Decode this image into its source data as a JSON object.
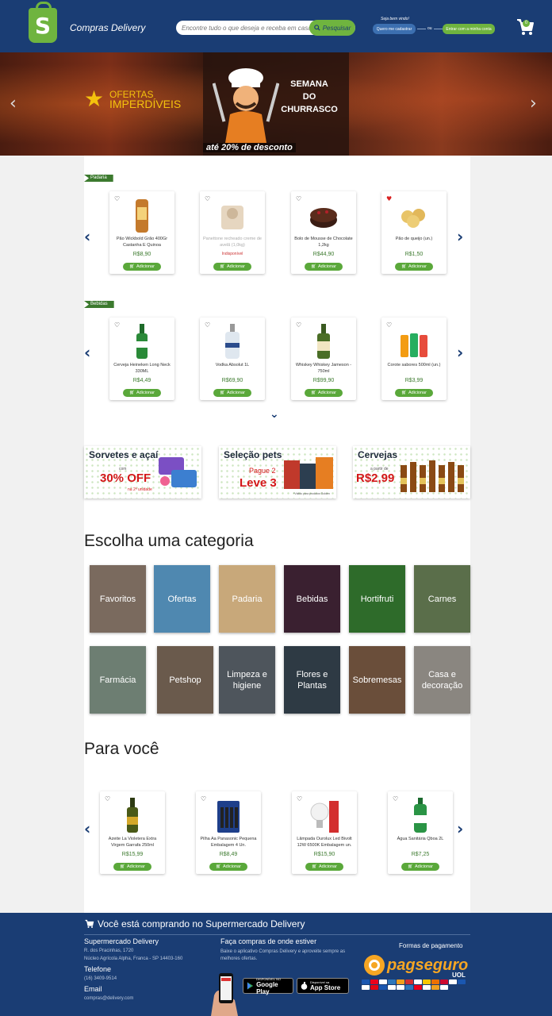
{
  "header": {
    "logo_letter": "S",
    "brand": "Compras Delivery",
    "search_placeholder": "Encontre tudo o que deseja e receba em casa!",
    "search_button": "Pesquisar",
    "greeting": "Seja bem vindo!",
    "register_button": "Quero me cadastrar",
    "or_text": "ou",
    "login_button": "Entrar com a minha conta",
    "cart_count": "0"
  },
  "banner": {
    "ofertas_line1": "OFERTAS",
    "ofertas_line2": "IMPERDÍVEIS",
    "semana_line1": "SEMANA",
    "semana_line2": "DO",
    "semana_line3": "CHURRASCO",
    "desconto": "até 20% de desconto"
  },
  "add_label": "Adicionar",
  "sections": [
    {
      "tag": "Padaria",
      "products": [
        {
          "name": "Pão Wickbold Grão 400Gr Castanha E Quinoa",
          "price": "R$8,90",
          "fav": false
        },
        {
          "name": "Panettone recheado creme de avelã (1,0kg)",
          "price": "Indisponível",
          "fav": false,
          "unavailable": true
        },
        {
          "name": "Bolo de Mousse de Chocolate 1,2kg",
          "price": "R$44,90",
          "fav": false
        },
        {
          "name": "Pão de queijo (un.)",
          "price": "R$1,50",
          "fav": true
        }
      ]
    },
    {
      "tag": "Bebidas",
      "products": [
        {
          "name": "Cerveja Heineken Long Neck 330ML",
          "price": "R$4,49",
          "fav": false
        },
        {
          "name": "Vodka Absolut 1L",
          "price": "R$69,90",
          "fav": false
        },
        {
          "name": "Whiskey Whiskey Jameson - 750ml",
          "price": "R$99,90",
          "fav": false
        },
        {
          "name": "Corote sabores 500ml (un.)",
          "price": "R$3,99",
          "fav": false
        }
      ]
    }
  ],
  "promos": [
    {
      "title": "Sorvetes e açaí",
      "small_top": "com",
      "big": "30% OFF",
      "small_bottom": "na 2ª unidade"
    },
    {
      "title": "Seleção pets",
      "sub": "Pague 2",
      "big": "Leve 3",
      "small_bottom": "*Válido para produtos Golden"
    },
    {
      "title": "Cervejas",
      "small_top": "a partir de",
      "big": "R$2,99"
    }
  ],
  "category_title": "Escolha uma categoria",
  "categories": [
    [
      "Favoritos",
      "Ofertas",
      "Padaria",
      "Bebidas",
      "Hortifruti",
      "Carnes"
    ],
    [
      "Farmácia",
      "Petshop",
      "Limpeza e higiene",
      "Flores e Plantas",
      "Sobremesas",
      "Casa e decoração"
    ]
  ],
  "para_voce_title": "Para você",
  "para_voce": [
    {
      "name": "Azeite La Violetera Extra Virgem Garrafa 250ml",
      "price": "R$15,99"
    },
    {
      "name": "Pilha Aa Panasonic Pequena Embalagem 4 Un.",
      "price": "R$8,49"
    },
    {
      "name": "Lâmpada Ourolux Led Bivolt 12W 6500K Embalagem un.",
      "price": "R$15,90"
    },
    {
      "name": "Água Sanitária Qboa 2L",
      "price": "R$7,25"
    }
  ],
  "footer": {
    "title": "Você está comprando no Supermercado Delivery",
    "store_name": "Supermercado Delivery",
    "address1": "R. dos Pracinhas, 1720",
    "address2": "Núcleo Agrícola Alpha, Franca - SP 14403-160",
    "phone_label": "Telefone",
    "phone": "(16) 3409-9514",
    "email_label": "Email",
    "email": "compras@delivery.com",
    "app_title": "Faça compras de onde estiver",
    "app_text": "Baixe o aplicativo Compras Delivery e aproveite sempre as melhores ofertas.",
    "gplay_small": "DISPONÍVEL NO",
    "gplay_big": "Google Play",
    "appstore_small": "Disponível na",
    "appstore_big": "App Store",
    "payment_title": "Formas de pagamento",
    "pagseguro": "pagseguro",
    "uol": "UOL"
  }
}
